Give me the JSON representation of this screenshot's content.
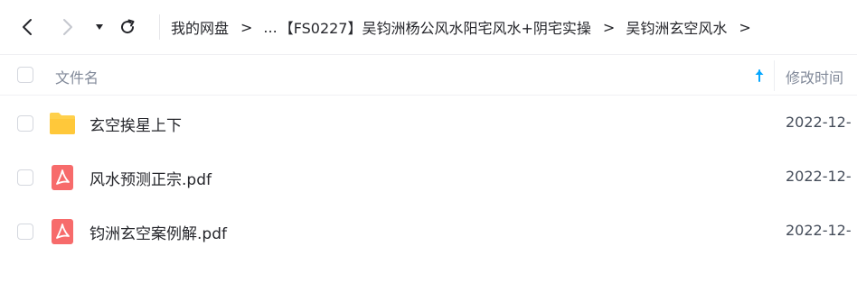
{
  "navbar": {
    "breadcrumbs": [
      "我的网盘",
      "...",
      "【FS0227】吴钧洲杨公风水阳宅风水+阴宅实操",
      "吴钧洲玄空风水"
    ],
    "separator": ">"
  },
  "header": {
    "name_label": "文件名",
    "time_label": "修改时间"
  },
  "files": [
    {
      "icon": "folder-icon",
      "name": "玄空挨星上下",
      "time": "2022-12-"
    },
    {
      "icon": "pdf-icon",
      "name": "风水预测正宗.pdf",
      "time": "2022-12-"
    },
    {
      "icon": "pdf-icon",
      "name": "钧洲玄空案例解.pdf",
      "time": "2022-12-"
    }
  ],
  "colors": {
    "accent": "#06a7ff",
    "folder": "#ffd04b",
    "pdf": "#f76b6b",
    "text": "#25262b",
    "muted": "#818999"
  }
}
